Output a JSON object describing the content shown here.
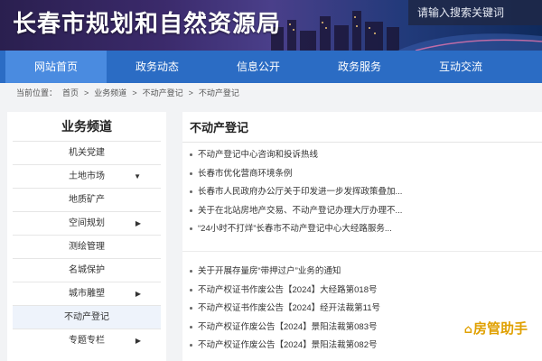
{
  "header": {
    "site_title": "长春市规划和自然资源局",
    "search_placeholder": "请输入搜索关键词"
  },
  "nav": {
    "items": [
      "网站首页",
      "政务动态",
      "信息公开",
      "政务服务",
      "互动交流"
    ],
    "active_index": 0
  },
  "breadcrumb": {
    "prefix": "当前位置：",
    "items": [
      "首页",
      ">",
      "业务频道",
      ">",
      "不动产登记",
      ">",
      "不动产登记"
    ]
  },
  "sidebar": {
    "title": "业务频道",
    "items": [
      {
        "label": "机关党建",
        "has_arrow": false
      },
      {
        "label": "土地市场",
        "has_arrow": true
      },
      {
        "label": "地质矿产",
        "has_arrow": false
      },
      {
        "label": "空间规划",
        "has_arrow": true
      },
      {
        "label": "测绘管理",
        "has_arrow": false
      },
      {
        "label": "名城保护",
        "has_arrow": false
      },
      {
        "label": "城市雕塑",
        "has_arrow": true
      },
      {
        "label": "不动产登记",
        "has_arrow": false
      },
      {
        "label": "专题专栏",
        "has_arrow": true
      }
    ],
    "arrow_glyph": "▼",
    "arrow_glyph_right": "▶"
  },
  "main": {
    "section_title": "不动产登记",
    "group1": [
      "不动产登记中心咨询和投诉热线",
      "长春市优化营商环境条例",
      "长春市人民政府办公厅关于印发进一步发挥政策叠加...",
      "关于在北站房地产交易、不动产登记办理大厅办理不...",
      "“24小时不打烊”长春市不动产登记中心大经路服务..."
    ],
    "group2": [
      "关于开展存量房“带押过户”业务的通知",
      "不动产权证书作废公告【2024】大经路第018号",
      "不动产权证书作废公告【2024】经开法裁第11号",
      "不动产权证作废公告【2024】景阳法裁第083号",
      "不动产权证作废公告【2024】景阳法裁第082号"
    ]
  },
  "watermark": {
    "text": "房管助手"
  }
}
